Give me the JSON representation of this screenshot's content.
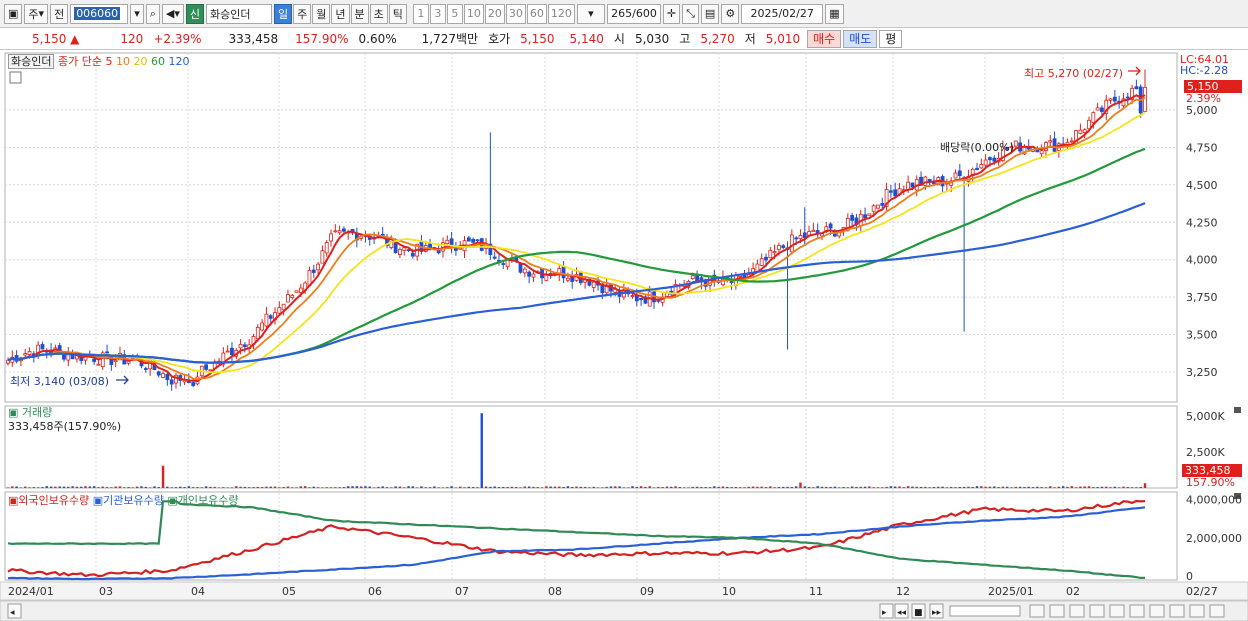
{
  "toolbar": {
    "mode_main": "주",
    "mode_prev": "전",
    "stock_code": "006060",
    "sin_badge": "신",
    "stock_name": "화승인더",
    "periods": [
      "일",
      "주",
      "월",
      "년",
      "분",
      "초",
      "틱"
    ],
    "active_period": "일",
    "intervals": [
      "1",
      "3",
      "5",
      "10",
      "20",
      "30",
      "60",
      "120"
    ],
    "bar_count": "265",
    "bar_total": "/600",
    "date": "2025/02/27"
  },
  "quote": {
    "price": "5,150",
    "change": "120",
    "change_pct": "+2.39%",
    "volume": "333,458",
    "volume_ratio": "157.90%",
    "turnover": "0.60%",
    "amount": "1,727백만",
    "ask_label": "호가",
    "ask1": "5,150",
    "ask2": "5,140",
    "open_label": "시",
    "open": "5,030",
    "high_label": "고",
    "high": "5,270",
    "low_label": "저",
    "low": "5,010",
    "buy_label": "매수",
    "sell_label": "매도",
    "eval_label": "평"
  },
  "price_legend": {
    "name": "화승인더",
    "ma_prefix": "종가 단순",
    "ma_labels": [
      "5",
      "10",
      "20",
      "60",
      "120"
    ],
    "lc_label": "LC:64.01",
    "hc_label": "HC:-2.28",
    "current_price_tag": "5,150",
    "current_pct_tag": "2.39%",
    "high_note": "최고 5,270 (02/27)",
    "low_note": "최저 3,140 (03/08)",
    "dividend_note": "배당락(0.00%)"
  },
  "volume_legend": {
    "title": "거래량",
    "summary": "333,458주(157.90%)",
    "current_tag": "333,458",
    "current_pct_tag": "157.90%"
  },
  "holding_legend": {
    "labels": [
      "외국인보유수량",
      "기관보유수량",
      "개인보유수량"
    ]
  },
  "colors": {
    "up": "#e0201c",
    "down": "#1f4fd1",
    "ma5": "#e0201c",
    "ma10": "#f07c1a",
    "ma20": "#f4e418",
    "ma60": "#239a3a",
    "ma120": "#2b5fd6",
    "foreign": "#d42020",
    "institution": "#2b5fd6",
    "individual": "#2f8a55"
  },
  "chart_data": [
    {
      "type": "candlestick",
      "title": "화승인더",
      "y_ticks": [
        3250,
        3500,
        3750,
        4000,
        4250,
        4500,
        4750,
        5000
      ],
      "y_tick_labels": [
        "3,250",
        "3,500",
        "3,750",
        "4,000",
        "4,250",
        "4,500",
        "4,750",
        "5,000"
      ],
      "ylim": [
        3050,
        5380
      ],
      "x_tick_labels": [
        "2024/01",
        "03",
        "04",
        "05",
        "06",
        "07",
        "08",
        "09",
        "10",
        "11",
        "12",
        "2025/01",
        "02",
        "02/27"
      ],
      "anchors": [
        {
          "month": "2024/01",
          "close": 3330
        },
        {
          "month": "2024/02",
          "close": 3400
        },
        {
          "month": "2024/03",
          "close": 3200
        },
        {
          "month": "2024/04",
          "close": 3440
        },
        {
          "month": "2024/05",
          "close": 4150
        },
        {
          "month": "2024/06",
          "close": 4100
        },
        {
          "month": "2024/07",
          "close": 4050
        },
        {
          "month": "2024/08",
          "close": 3850
        },
        {
          "month": "2024/09",
          "close": 3760
        },
        {
          "month": "2024/10",
          "close": 3900
        },
        {
          "month": "2024/11",
          "close": 4180
        },
        {
          "month": "2024/12",
          "close": 4450
        },
        {
          "month": "2025/01",
          "close": 4650
        },
        {
          "month": "2025/02",
          "close": 4820
        },
        {
          "month": "2025/02/27",
          "close": 5150
        }
      ],
      "high": {
        "value": 5270,
        "date": "02/27"
      },
      "low": {
        "value": 3140,
        "date": "03/08"
      },
      "series": [
        {
          "name": "5",
          "type": "line"
        },
        {
          "name": "10",
          "type": "line"
        },
        {
          "name": "20",
          "type": "line"
        },
        {
          "name": "60",
          "type": "line"
        },
        {
          "name": "120",
          "type": "line"
        }
      ]
    },
    {
      "type": "bar",
      "title": "거래량",
      "y_ticks": [
        2500000,
        5000000
      ],
      "y_tick_labels": [
        "2,500K",
        "5,000K"
      ],
      "ylim": [
        0,
        5700000
      ],
      "last_value": 333458,
      "spikes": [
        {
          "month": "2024/02",
          "value": 1550000
        },
        {
          "month": "2024/06",
          "value": 5200000
        },
        {
          "month": "2024/08",
          "value": 380000
        }
      ]
    },
    {
      "type": "line",
      "y_ticks": [
        0,
        2000000,
        4000000
      ],
      "y_tick_labels": [
        "0",
        "2,000,000",
        "4,000,000"
      ],
      "ylim": [
        -200000,
        4400000
      ],
      "series": [
        {
          "name": "외국인보유수량",
          "values": [
            300000,
            50000,
            300000,
            1400000,
            2600000,
            2000000,
            1300000,
            1100000,
            1200000,
            1200000,
            1500000,
            2700000,
            3500000,
            3400000,
            4000000
          ]
        },
        {
          "name": "기관보유수량",
          "values": [
            -100000,
            -150000,
            -100000,
            100000,
            350000,
            600000,
            1300000,
            1400000,
            1700000,
            2000000,
            2200000,
            2600000,
            2900000,
            3100000,
            3600000
          ]
        },
        {
          "name": "개인보유수량",
          "values": [
            1700000,
            3900000,
            3800000,
            3600000,
            2900000,
            2700000,
            2500000,
            2300000,
            2100000,
            2000000,
            1700000,
            900000,
            600000,
            300000,
            -100000
          ]
        }
      ]
    }
  ]
}
